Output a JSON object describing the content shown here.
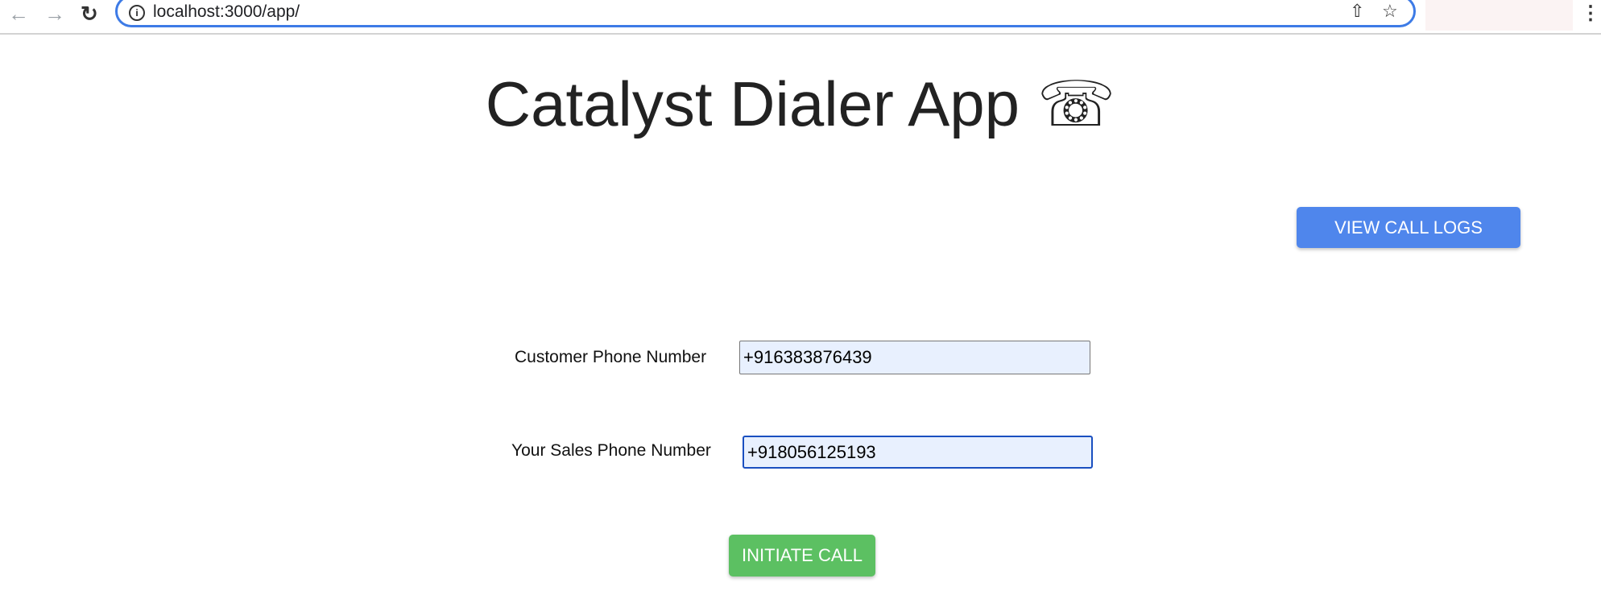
{
  "browser": {
    "url": "localhost:3000/app/",
    "icons": [
      "back-icon",
      "forward-icon",
      "reload-icon",
      "info-icon",
      "share-icon",
      "star-icon",
      "menu-icon"
    ]
  },
  "page": {
    "title": "Catalyst Dialer App ☏",
    "view_logs_label": "VIEW CALL LOGS",
    "customer_label": "Customer Phone Number",
    "customer_value": "+916383876439",
    "sales_label": "Your Sales Phone Number",
    "sales_value": "+918056125193",
    "initiate_label": "INITIATE CALL"
  },
  "colors": {
    "primary": "#4f86ec",
    "success": "#5cc062",
    "focus": "#1a4fc0"
  }
}
